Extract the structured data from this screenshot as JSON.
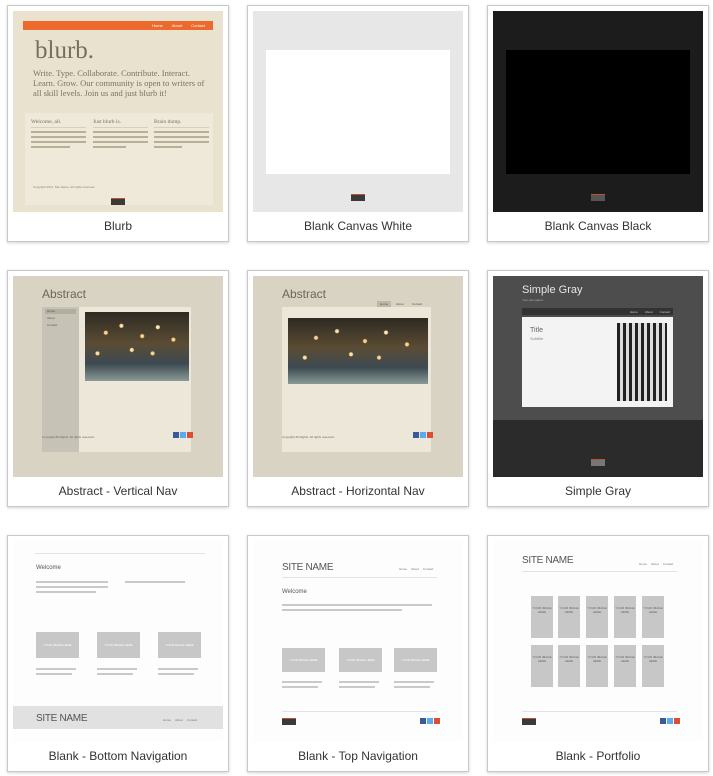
{
  "templates": [
    {
      "label": "Blurb"
    },
    {
      "label": "Blank Canvas White"
    },
    {
      "label": "Blank Canvas Black"
    },
    {
      "label": "Abstract - Vertical Nav"
    },
    {
      "label": "Abstract - Horizontal Nav"
    },
    {
      "label": "Simple Gray"
    },
    {
      "label": "Blank - Bottom Navigation"
    },
    {
      "label": "Blank - Top Navigation"
    },
    {
      "label": "Blank - Portfolio"
    }
  ],
  "blurb": {
    "title": "blurb.",
    "intro": "Write. Type. Collaborate. Contribute. Interact. Learn. Grow. Our community is open to writers of all skill levels. Join us and just blurb it!",
    "nav": [
      "Home",
      "About",
      "Contact"
    ],
    "columns": [
      "Welcome, all.",
      "Just blurb is.",
      "Brain dump."
    ],
    "footer": "Copyright 2011. Site Name. All rights reserved."
  },
  "abstract": {
    "title": "Abstract",
    "nav": [
      "Home",
      "About",
      "Contact"
    ],
    "footer": "Copyright All Rights. All rights reserved."
  },
  "simple_gray": {
    "title": "Simple Gray",
    "subtitle": "Your site tagline",
    "nav": [
      "Home",
      "About",
      "Contact"
    ],
    "page_title": "Title",
    "page_subtitle": "Subtitle"
  },
  "blank": {
    "welcome": "Welcome",
    "site_name": "SITE NAME",
    "image_placeholder": "YOUR IMAGE HERE",
    "nav": [
      "Home",
      "About",
      "Contact"
    ]
  },
  "colors": {
    "blurb_accent": "#ec6a2e",
    "card_border": "#c9c9c9",
    "label_text": "#333333"
  }
}
